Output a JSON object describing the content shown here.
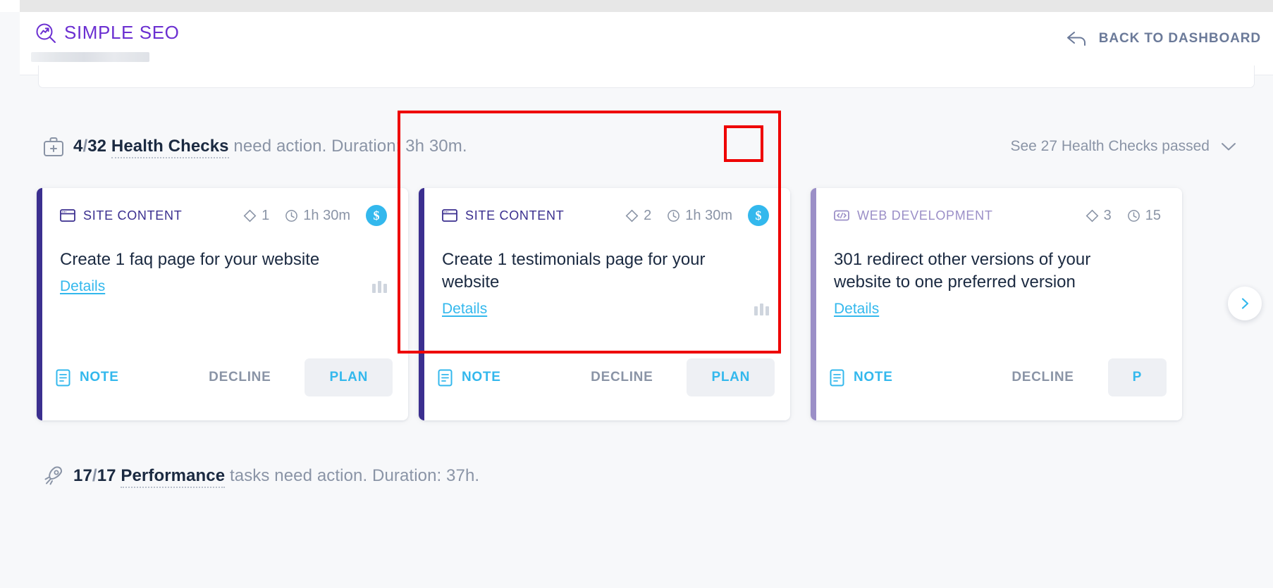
{
  "header": {
    "brand_name": "SIMPLE SEO",
    "brand_icon": "seo-magnifier-icon",
    "back_label": "BACK TO DASHBOARD",
    "back_icon": "back-arrow-icon"
  },
  "sections": [
    {
      "id": "health-checks",
      "icon": "medical-kit-icon",
      "count": "4",
      "slash": "/",
      "total": "32",
      "noun": "Health Checks",
      "tail": " need action. Duration: 3h 30m.",
      "aside_label": "See 27 Health Checks passed",
      "aside_icon": "chevron-down-icon"
    },
    {
      "id": "performance",
      "icon": "rocket-icon",
      "count": "17",
      "slash": "/",
      "total": "17",
      "noun": "Performance",
      "tail": " tasks need action. Duration: 37h.",
      "aside_label": "",
      "aside_icon": ""
    }
  ],
  "colors": {
    "brand_purple": "#6B2FD1",
    "accent_cyan": "#33B8ED",
    "site_content_bar": "#3B2F8F",
    "web_dev_bar": "#9B8FC7",
    "annotation_red": "#EE0000",
    "muted_text": "#8A94A6",
    "dark_text": "#1B2A41"
  },
  "cards": [
    {
      "category": "SITE CONTENT",
      "category_icon": "browser-window-icon",
      "category_color": "#3B2F8F",
      "bar_color": "#3B2F8F",
      "points": "1",
      "points_icon": "diamond-icon",
      "duration": "1h 30m",
      "duration_icon": "clock-icon",
      "cost_badge": "$",
      "title": "Create 1 faq page for your website",
      "details_label": "Details",
      "priority_icon": "priority-bars-icon",
      "note_label": "NOTE",
      "note_icon": "note-document-icon",
      "decline_label": "DECLINE",
      "plan_label": "PLAN"
    },
    {
      "category": "SITE CONTENT",
      "category_icon": "browser-window-icon",
      "category_color": "#3B2F8F",
      "bar_color": "#3B2F8F",
      "points": "2",
      "points_icon": "diamond-icon",
      "duration": "1h 30m",
      "duration_icon": "clock-icon",
      "cost_badge": "$",
      "title": "Create 1 testimonials page for your website",
      "details_label": "Details",
      "priority_icon": "priority-bars-icon",
      "note_label": "NOTE",
      "note_icon": "note-document-icon",
      "decline_label": "DECLINE",
      "plan_label": "PLAN"
    },
    {
      "category": "WEB DEVELOPMENT",
      "category_icon": "code-brackets-icon",
      "category_color": "#9B8FC7",
      "bar_color": "#9B8FC7",
      "points": "3",
      "points_icon": "diamond-icon",
      "duration": "15",
      "duration_icon": "clock-icon",
      "cost_badge": "",
      "title": "301 redirect other versions of your website to one preferred version",
      "details_label": "Details",
      "priority_icon": "priority-bars-icon",
      "note_label": "NOTE",
      "note_icon": "note-document-icon",
      "decline_label": "DECLINE",
      "plan_label": "P"
    }
  ],
  "rail": {
    "next_icon": "chevron-right-icon"
  },
  "annotations": [
    {
      "name": "highlight-card-2",
      "color": "#EE0000"
    },
    {
      "name": "highlight-cost-badge",
      "color": "#EE0000"
    }
  ]
}
